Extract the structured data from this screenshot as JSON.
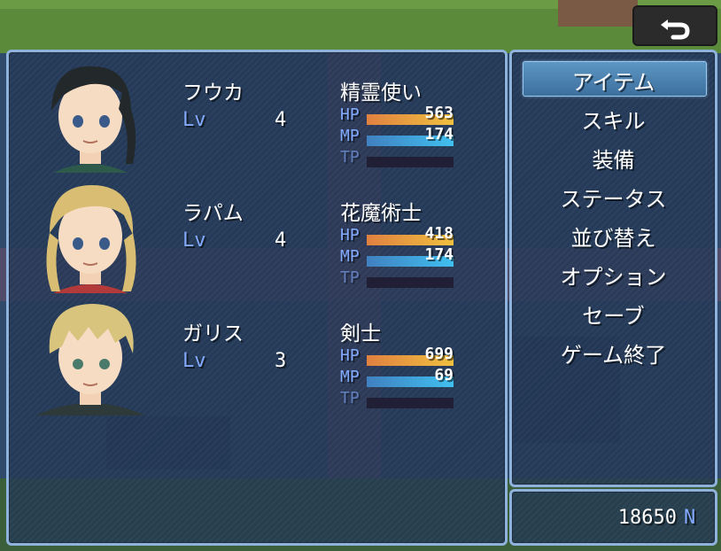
{
  "menu": {
    "items": [
      {
        "label": "アイテム"
      },
      {
        "label": "スキル"
      },
      {
        "label": "装備"
      },
      {
        "label": "ステータス"
      },
      {
        "label": "並び替え"
      },
      {
        "label": "オプション"
      },
      {
        "label": "セーブ"
      },
      {
        "label": "ゲーム終了"
      }
    ],
    "selected_index": 0
  },
  "gold": {
    "value": "18650",
    "unit": "N"
  },
  "labels": {
    "lv": "Lv",
    "hp": "HP",
    "mp": "MP",
    "tp": "TP"
  },
  "actors": [
    {
      "name": "フウカ",
      "class": "精霊使い",
      "level": "4",
      "hp": "563",
      "mp": "174",
      "hp_rate": 1.0,
      "mp_rate": 1.0,
      "tp_rate": 0.0,
      "hair": "#23282a"
    },
    {
      "name": "ラパム",
      "class": "花魔術士",
      "level": "4",
      "hp": "418",
      "mp": "174",
      "hp_rate": 1.0,
      "mp_rate": 1.0,
      "tp_rate": 0.0,
      "hair": "#d8bd72"
    },
    {
      "name": "ガリス",
      "class": "剣士",
      "level": "3",
      "hp": "699",
      "mp": "69",
      "hp_rate": 1.0,
      "mp_rate": 1.0,
      "tp_rate": 0.0,
      "hair": "#d9c47e"
    }
  ],
  "colors": {
    "hp_gauge": "#e0a040",
    "mp_gauge": "#40a0e0",
    "system_text": "#84aaff",
    "window_border": "#8fb2dc"
  },
  "icons": {
    "back": "back-arrow-icon"
  }
}
